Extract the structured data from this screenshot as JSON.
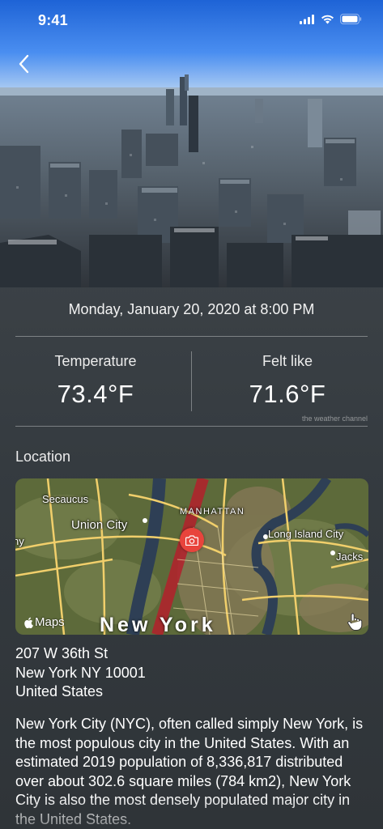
{
  "status_bar": {
    "time": "9:41",
    "icons": [
      "cellular-signal-icon",
      "wifi-icon",
      "battery-icon"
    ]
  },
  "navigation": {
    "back_icon": "chevron-left-icon"
  },
  "hero": {
    "subject": "city-skyline-photo"
  },
  "observation": {
    "datetime": "Monday, January 20, 2020 at 8:00 PM",
    "temperature_label": "Temperature",
    "temperature_value": "73.4°F",
    "felt_label": "Felt like",
    "felt_value": "71.6°F",
    "attribution": "the weather channel"
  },
  "location": {
    "section_title": "Location",
    "map": {
      "labels": {
        "secaucus": "Secaucus",
        "union_city": "Union City",
        "manhattan": "MANHATTAN",
        "long_island_city": "Long Island City",
        "jackson": "Jacks",
        "ny_edge": "ny"
      },
      "city_label": "New York",
      "brand": "Maps",
      "pin_icon": "camera-icon",
      "gesture_icon": "hand-pointer-icon"
    },
    "address": {
      "line1": "207 W 36th St",
      "line2": "New York NY 10001",
      "line3": "United States"
    }
  },
  "description": "New York City (NYC), often called simply New York, is the most populous city in the United States. With an estimated 2019 population of 8,336,817 distributed over about 302.6 square miles (784 km2), New York City is also the most densely populated major city in the United States.",
  "colors": {
    "background": "#3b4146",
    "pin": "#e8443c",
    "text": "#ffffff"
  }
}
